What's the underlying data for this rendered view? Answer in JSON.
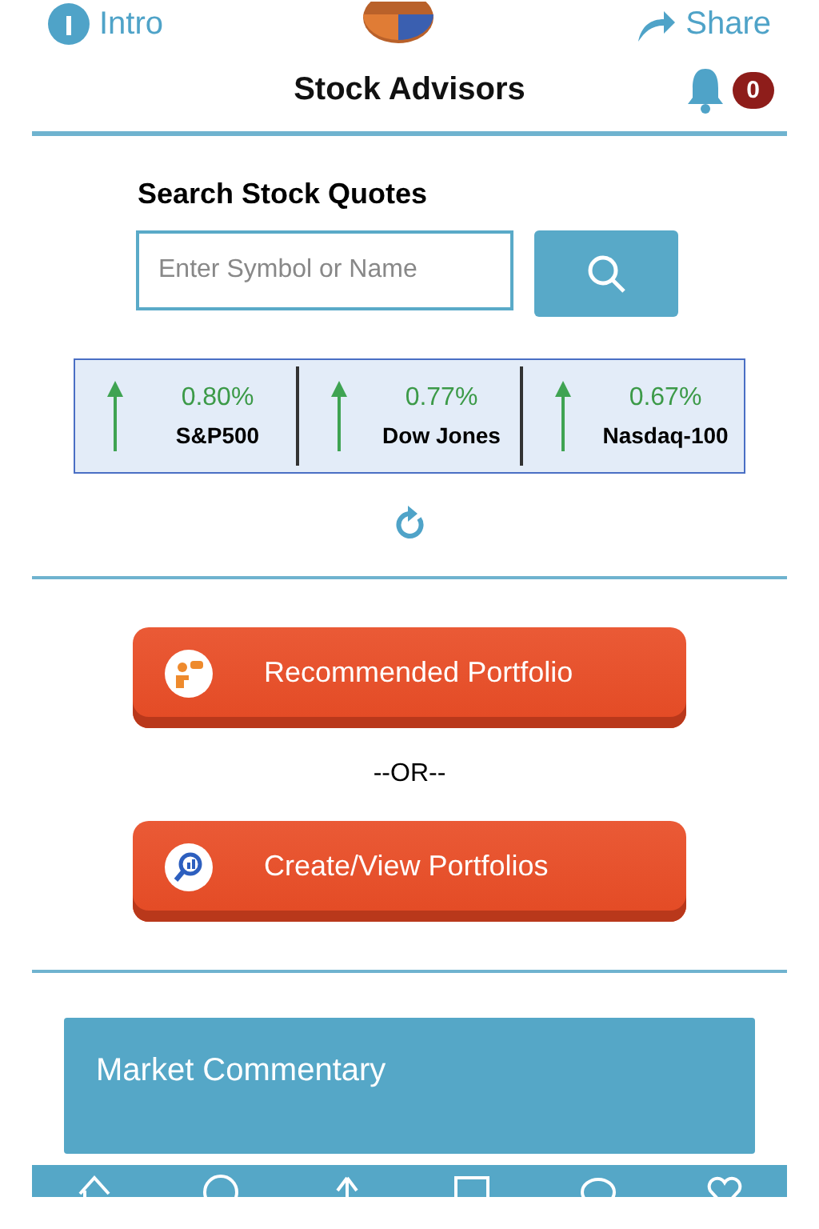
{
  "top_bar": {
    "intro": "Intro",
    "share": "Share"
  },
  "header": {
    "title": "Stock Advisors",
    "notification_count": "0"
  },
  "search": {
    "heading": "Search Stock Quotes",
    "placeholder": "Enter Symbol or Name"
  },
  "indices": [
    {
      "change": "0.80%",
      "name": "S&P500",
      "kind": "up"
    },
    {
      "change": "0.77%",
      "name": "Dow Jones",
      "kind": "up"
    },
    {
      "change": "0.67%",
      "name": "Nasdaq-100",
      "kind": "up"
    }
  ],
  "actions": [
    {
      "label": "Recommended Portfolio",
      "kind": "advisor"
    },
    {
      "label": "Create/View Portfolios",
      "kind": "analysis"
    }
  ],
  "separator": "--OR--",
  "market_commentary": {
    "title": "Market Commentary"
  },
  "tab_bar": {
    "tabs": [
      {
        "kind": "home"
      },
      {
        "kind": "circle"
      },
      {
        "kind": "up"
      },
      {
        "kind": "doc"
      },
      {
        "kind": "chat"
      },
      {
        "kind": "heart"
      }
    ]
  }
}
